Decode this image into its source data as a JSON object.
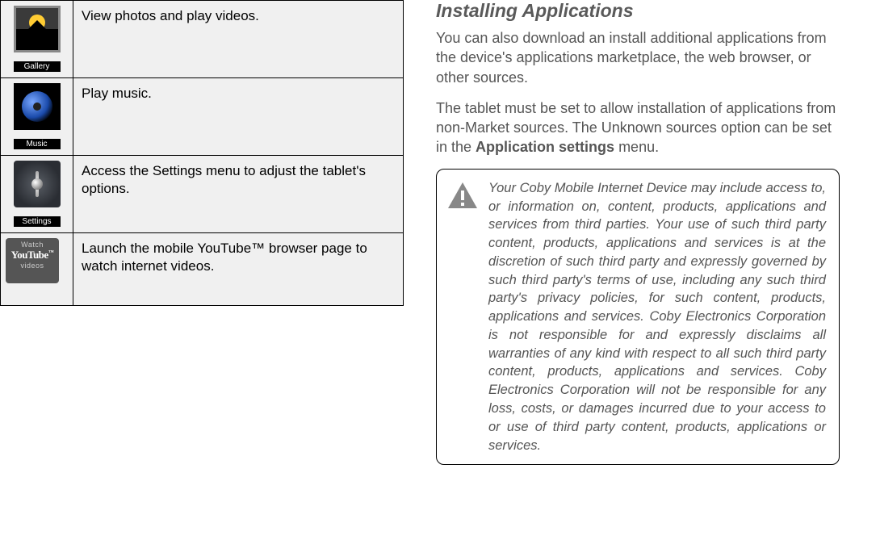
{
  "table": {
    "rows": [
      {
        "iconLabel": "Gallery",
        "desc": "View photos and play videos."
      },
      {
        "iconLabel": "Music",
        "desc": "Play music."
      },
      {
        "iconLabel": "Settings",
        "desc": "Access the Settings menu to adjust the tablet's options."
      },
      {
        "iconLabel": "",
        "desc": "Launch the mobile YouTube™ browser page to watch internet videos."
      }
    ]
  },
  "youtube": {
    "line1": "Watch",
    "line2": "YouTube",
    "tm": "™",
    "line3": "videos"
  },
  "right": {
    "heading": "Installing Applications",
    "para1": "You can also download an install additional applications from the device's applications marketplace, the web browser, or other sources.",
    "para2a": "The tablet must be set to allow installation of applications from non-Market sources. The Unknown sources option can be set in the ",
    "para2b": "Application settings",
    "para2c": " menu.",
    "note": "Your Coby Mobile Internet Device may include access to, or information on, content, products, applications and services from third parties. Your use of such third party content, products, applications and services is at the discretion of such third party and expressly governed by such third party's terms of use, including any such third party's privacy policies, for such content, products, applications and services. Coby Electronics Corporation is not responsible for and expressly disclaims all warranties of any kind with respect to all such third party content, products, applications and services. Coby Electronics Corporation will not be responsible for any loss, costs, or damages incurred due to your access to or use of third party content, products, applications or services."
  }
}
